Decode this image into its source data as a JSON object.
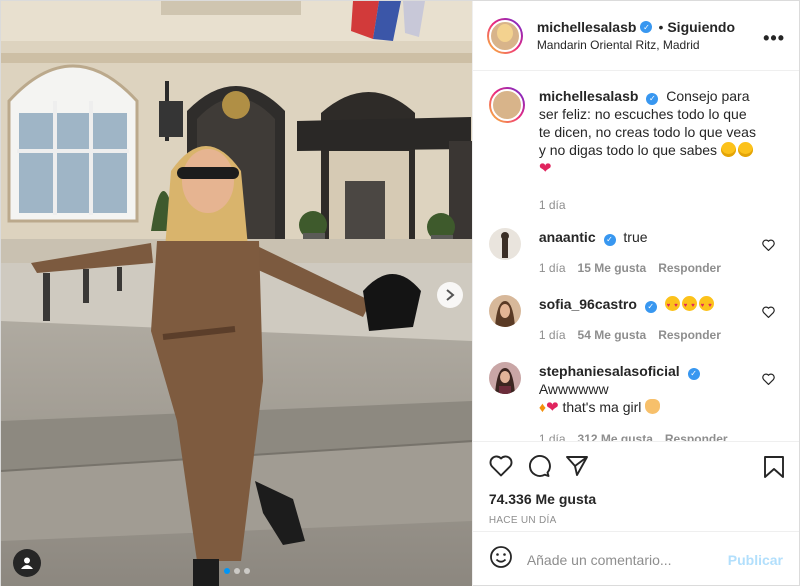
{
  "header": {
    "username": "michellesalasb",
    "separator": "•",
    "following_label": "Siguiendo",
    "location": "Mandarin Oriental Ritz, Madrid",
    "more_glyph": "•••"
  },
  "caption": {
    "username": "michellesalasb",
    "text": "Consejo para ser feliz: no escuches todo lo que te dicen, no creas todo lo que veas y no digas todo lo que sabes",
    "time": "1 día"
  },
  "comments": [
    {
      "username": "anaantic",
      "text": "true",
      "time": "1 día",
      "likes": "15 Me gusta",
      "reply": "Responder"
    },
    {
      "username": "sofia_96castro",
      "text": "",
      "time": "1 día",
      "likes": "54 Me gusta",
      "reply": "Responder"
    },
    {
      "username": "stephaniesalasoficial",
      "text": "Awwwwww",
      "text2": "that's ma girl",
      "time": "1 día",
      "likes": "312 Me gusta",
      "reply": "Responder"
    }
  ],
  "actions": {
    "likes": "74.336 Me gusta",
    "date": "HACE UN DÍA"
  },
  "add_comment": {
    "placeholder": "Añade un comentario...",
    "publish_label": "Publicar"
  },
  "carousel": {
    "count": 3,
    "active": 1
  },
  "colors": {
    "accent": "#0095f6",
    "publish": "#b2dffc",
    "verified": "#3897f0"
  },
  "icons": [
    "heart-icon",
    "comment-icon",
    "share-icon",
    "bookmark-icon",
    "emoji-icon",
    "more-icon",
    "tag-user-icon",
    "next-arrow-icon"
  ]
}
